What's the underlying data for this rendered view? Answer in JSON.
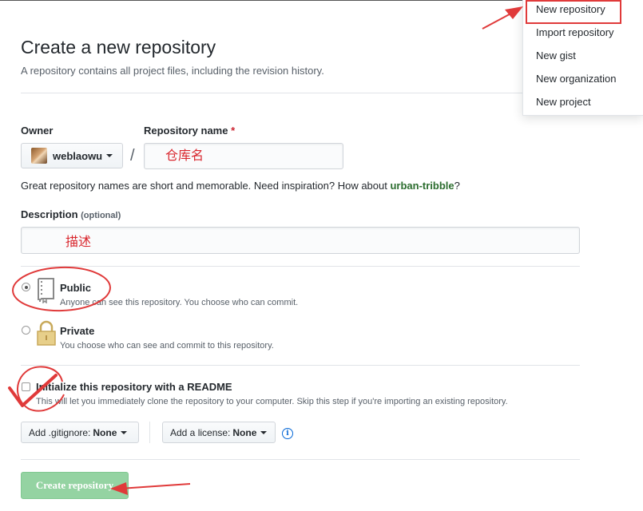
{
  "header": {
    "title": "Create a new repository",
    "subtitle": "A repository contains all project files, including the revision history."
  },
  "owner": {
    "label": "Owner",
    "value": "weblaowu"
  },
  "repo_name": {
    "label": "Repository name",
    "required_mark": "*",
    "annotation": "仓库名"
  },
  "slash": "/",
  "name_hint": {
    "prefix": "Great repository names are short and memorable. Need inspiration? How about ",
    "suggestion": "urban-tribble",
    "suffix": "?"
  },
  "description": {
    "label": "Description",
    "optional": "(optional)",
    "annotation": "描述"
  },
  "visibility": {
    "public": {
      "title": "Public",
      "desc": "Anyone can see this repository. You choose who can commit."
    },
    "private": {
      "title": "Private",
      "desc": "You choose who can see and commit to this repository."
    }
  },
  "init_readme": {
    "title": "Initialize this repository with a README",
    "desc": "This will let you immediately clone the repository to your computer. Skip this step if you're importing an existing repository."
  },
  "gitignore": {
    "label": "Add .gitignore:",
    "value": "None"
  },
  "license": {
    "label": "Add a license:",
    "value": "None"
  },
  "info_glyph": "i",
  "create_button": "Create repository",
  "menu": {
    "items": [
      "New repository",
      "Import repository",
      "New gist",
      "New organization",
      "New project"
    ]
  },
  "colors": {
    "annotation_red": "#e03a3a",
    "primary_green_disabled": "#94d3a2",
    "link_blue": "#0366d6"
  }
}
